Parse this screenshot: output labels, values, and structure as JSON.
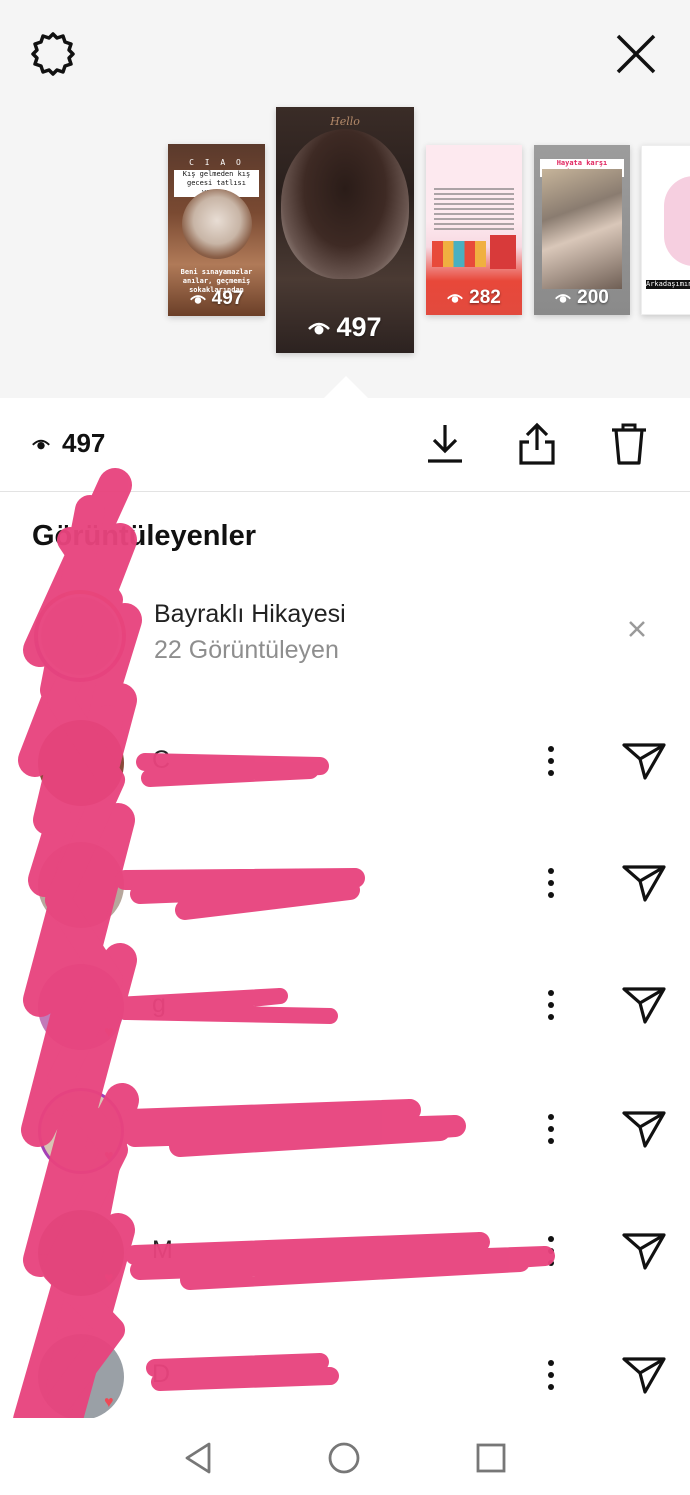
{
  "icons": {
    "settings": "gear-icon",
    "close": "close-icon",
    "eye": "eye-icon",
    "download": "download-icon",
    "share": "share-icon",
    "delete": "trash-icon",
    "more": "more-vertical-icon",
    "send": "send-icon"
  },
  "stories": [
    {
      "views": "497",
      "caption": "Kış gelmeden kış gecesi tatlısı yaptım.",
      "footer": "Beni sınayamazlar anılar, geçmemiş sokaklarından"
    },
    {
      "views": "497",
      "caption": "Hello"
    },
    {
      "views": "282"
    },
    {
      "views": "200",
      "caption": "Hayata karşı duruşum."
    },
    {
      "caption": "Arkadaşımın"
    }
  ],
  "selected": {
    "views": "497"
  },
  "viewers": {
    "title": "Görüntüleyenler",
    "highlight": {
      "title": "Bayraklı Hikayesi",
      "subtitle": "22 Görüntüleyen"
    },
    "rows": [
      {
        "name": "C"
      },
      {
        "name": ""
      },
      {
        "name": "g"
      },
      {
        "name": ""
      },
      {
        "name": "M"
      },
      {
        "name": "D"
      }
    ]
  },
  "colors": {
    "redaction": "#e8447e",
    "accent_heart": "#ed4956"
  }
}
